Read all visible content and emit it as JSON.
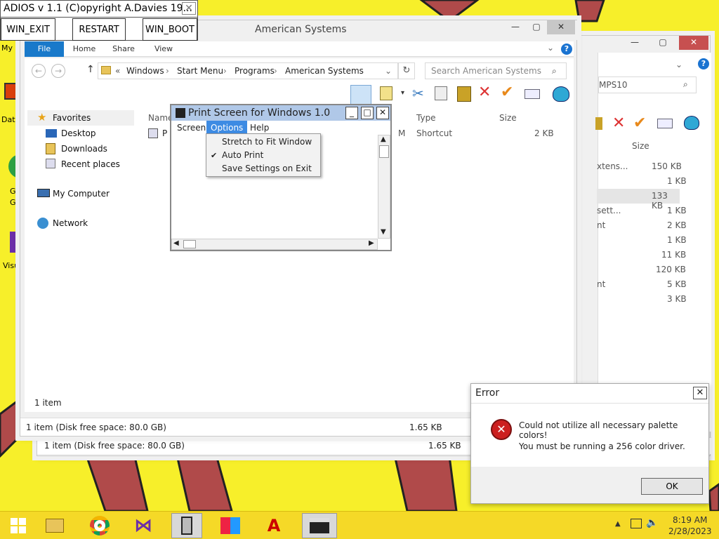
{
  "adios": {
    "title": "ADIOS  v 1.1 (C)opyright A.Davies 19...",
    "close": "✕",
    "buttons": [
      "WIN_EXIT",
      "RESTART",
      "WIN_BOOT"
    ]
  },
  "desktop": {
    "icons": [
      "My C",
      "Data",
      "G",
      "G",
      "Visu"
    ]
  },
  "back_explorer": {
    "caption": [
      "—",
      "▢"
    ],
    "search_text": "MPS10",
    "size_header": "Size",
    "rows": [
      {
        "name": "xtens...",
        "size": "150 KB"
      },
      {
        "name": "",
        "size": "1 KB"
      },
      {
        "name": "",
        "size": "133 KB"
      },
      {
        "name": "sett...",
        "size": "1 KB"
      },
      {
        "name": "nt",
        "size": "2 KB"
      },
      {
        "name": "",
        "size": "1 KB"
      },
      {
        "name": "",
        "size": "11 KB"
      },
      {
        "name": "",
        "size": "120 KB"
      },
      {
        "name": "nt",
        "size": "5 KB"
      },
      {
        "name": "",
        "size": "3 KB"
      }
    ],
    "status_left": "1 item (Disk free space: 80.0 GB)",
    "status_right": "1.65 KB"
  },
  "explorer": {
    "title": "American Systems",
    "caption": [
      "—",
      "▢",
      "✕"
    ],
    "tabs": [
      "File",
      "Home",
      "Share",
      "View"
    ],
    "breadcrumb": [
      "Windows",
      "Start Menu",
      "Programs",
      "American Systems"
    ],
    "search_placeholder": "Search American Systems",
    "nav": {
      "favorites": "Favorites",
      "desktop": "Desktop",
      "downloads": "Downloads",
      "recent": "Recent places",
      "computer": "My Computer",
      "network": "Network"
    },
    "columns": [
      "Name",
      "Type",
      "Size"
    ],
    "row": {
      "name": "P",
      "modified_tail": "M",
      "type": "Shortcut",
      "size": "2 KB"
    },
    "item_count": "1 item",
    "status_left": "1 item (Disk free space: 80.0 GB)",
    "status_right": "1.65 KB"
  },
  "printscreen": {
    "title": "Print Screen for Windows 1.0",
    "menu": [
      "Screen",
      "Options",
      "Help"
    ],
    "dropdown": [
      {
        "label": "Stretch to Fit Window",
        "checked": false
      },
      {
        "label": "Auto Print",
        "checked": true
      },
      {
        "label": "Save Settings on Exit",
        "checked": false
      }
    ]
  },
  "error": {
    "title": "Error",
    "line1": "Could not utilize all necessary palette colors!",
    "line2": "You must be running a 256 color driver.",
    "ok": "OK"
  },
  "taskbar": {
    "time": "8:19 AM",
    "date": "2/28/2023"
  }
}
